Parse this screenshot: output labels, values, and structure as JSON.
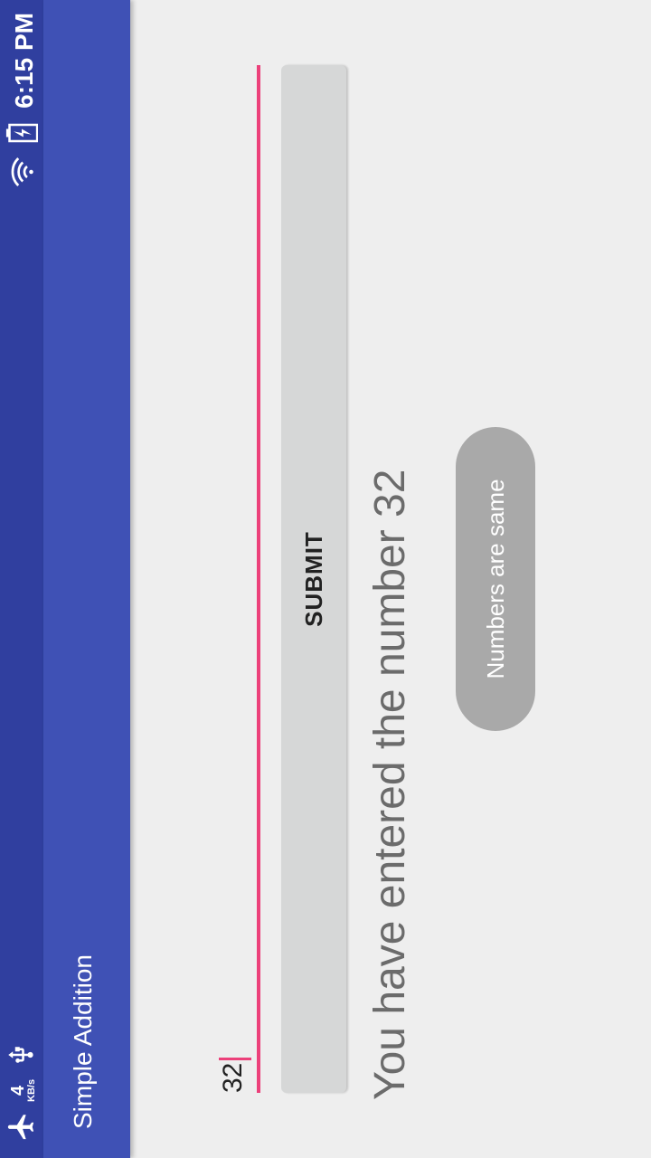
{
  "status_bar": {
    "network_speed_value": "4",
    "network_speed_unit": "KB/s",
    "time": "6:15 PM",
    "icons": [
      "airplane-icon",
      "usb-icon",
      "wifi-icon",
      "battery-charging-icon"
    ]
  },
  "app_bar": {
    "title": "Simple Addition"
  },
  "form": {
    "input_value": "32",
    "submit_label": "SUBMIT"
  },
  "result": {
    "text": "You have entered the number 32"
  },
  "toast": {
    "message": "Numbers are same"
  },
  "colors": {
    "status_bar": "#303f9f",
    "app_bar": "#3f51b5",
    "accent": "#ec407a",
    "background": "#eeeeee",
    "button": "#d6d7d7",
    "toast": "#a9a9a9"
  }
}
